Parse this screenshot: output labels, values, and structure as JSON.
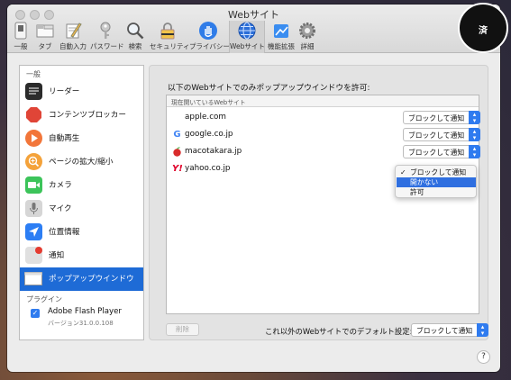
{
  "window": {
    "title": "Webサイト"
  },
  "toolbar": {
    "items": [
      {
        "label": "一般",
        "icon": "switch-icon"
      },
      {
        "label": "タブ",
        "icon": "tabs-icon"
      },
      {
        "label": "自動入力",
        "icon": "pencil-icon"
      },
      {
        "label": "パスワード",
        "icon": "key-icon"
      },
      {
        "label": "検索",
        "icon": "magnifier-icon"
      },
      {
        "label": "セキュリティ",
        "icon": "lock-icon"
      },
      {
        "label": "プライバシー",
        "icon": "hand-icon"
      },
      {
        "label": "Webサイト",
        "icon": "globe-icon",
        "selected": true
      },
      {
        "label": "機能拡張",
        "icon": "puzzle-icon"
      },
      {
        "label": "詳細",
        "icon": "gear-icon"
      }
    ]
  },
  "sidebar": {
    "general_header": "一般",
    "items": [
      {
        "label": "リーダー",
        "icon": "reader-icon",
        "color": "#2b2b2b"
      },
      {
        "label": "コンテンツブロッカー",
        "icon": "stop-sign-icon",
        "color": "#e04537"
      },
      {
        "label": "自動再生",
        "icon": "play-icon",
        "color": "#f2763a"
      },
      {
        "label": "ページの拡大/縮小",
        "icon": "zoom-icon",
        "color": "#f4a23a"
      },
      {
        "label": "カメラ",
        "icon": "camera-icon",
        "color": "#3cc45a"
      },
      {
        "label": "マイク",
        "icon": "microphone-icon",
        "color": "#c4c4c4"
      },
      {
        "label": "位置情報",
        "icon": "location-icon",
        "color": "#2c7ef4"
      },
      {
        "label": "通知",
        "icon": "notification-icon",
        "color": "#d9d9d9"
      },
      {
        "label": "ポップアップウインドウ",
        "icon": "popup-window-icon",
        "color": "#ffffff",
        "selected": true
      }
    ],
    "plugins_header": "プラグイン",
    "plugin": {
      "name": "Adobe Flash Player",
      "version": "バージョン31.0.0.108",
      "enabled": true
    }
  },
  "main": {
    "intro": "以下のWebサイトでのみポップアップウインドウを許可:",
    "list_header": "現在開いているWebサイト",
    "sites": [
      {
        "name": "apple.com",
        "icon": "apple-icon",
        "setting": "ブロックして通知"
      },
      {
        "name": "google.co.jp",
        "icon": "google-icon",
        "setting": "ブロックして通知"
      },
      {
        "name": "macotakara.jp",
        "icon": "macotakara-icon",
        "setting": "ブロックして通知"
      },
      {
        "name": "yahoo.co.jp",
        "icon": "yahoo-icon",
        "setting": "ブロックして通知"
      }
    ],
    "dropdown_options": [
      {
        "label": "ブロックして通知",
        "checked": true
      },
      {
        "label": "開かない",
        "highlighted": true
      },
      {
        "label": "許可"
      }
    ],
    "delete_button": "削除",
    "default_label": "これ以外のWebサイトでのデフォルト設定:",
    "default_value": "ブロックして通知"
  },
  "help": "?",
  "badge": {
    "text": "済"
  },
  "colors": {
    "accent": "#1e6bd6",
    "selection_bg": "#2f6fe0",
    "window_bg": "#ececec"
  }
}
